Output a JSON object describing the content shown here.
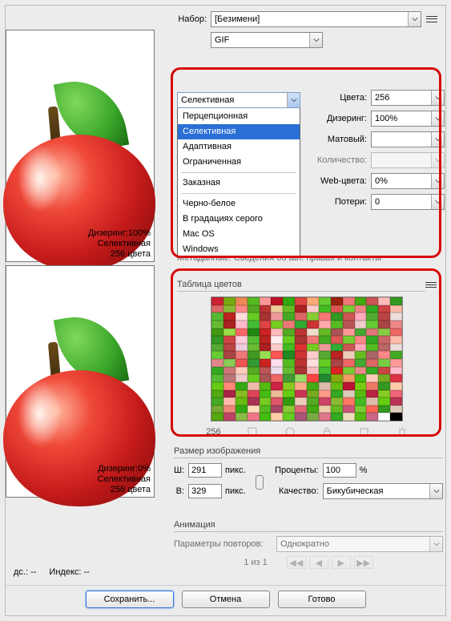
{
  "header": {
    "nabor_label": "Набор:",
    "nabor_value": "[Безимени]",
    "format": "GIF"
  },
  "preview1": {
    "dither": "Дизеринг:100%",
    "algo": "Селективная",
    "colors": "256 цвета"
  },
  "preview2": {
    "dither": "Дизеринг:0%",
    "algo": "Селективная",
    "colors": "256 цвета"
  },
  "dropdown": {
    "current": "Селективная",
    "options": [
      "Перцепционная",
      "Селективная",
      "Адаптивная",
      "Ограниченная",
      "Заказная",
      "Черно-белое",
      "В градациях серого",
      "Mac OS",
      "Windows"
    ]
  },
  "settings": {
    "colors_label": "Цвета:",
    "colors_value": "256",
    "dither_label": "Дизеринг:",
    "dither_value": "100%",
    "matte_label": "Матовый:",
    "matte_value": "",
    "qty_label": "Количество:",
    "qty_value": "",
    "web_label": "Web-цвета:",
    "web_value": "0%",
    "loss_label": "Потери:",
    "loss_value": "0"
  },
  "metadata_line": "Метаданные:   Сведения об авт. правах и контакты",
  "color_table": {
    "title": "Таблица цветов",
    "count": "256"
  },
  "size": {
    "title": "Размер изображения",
    "w_label": "Ш:",
    "w_value": "291",
    "h_label": "В:",
    "h_value": "329",
    "unit": "пикс.",
    "pct_label": "Проценты:",
    "pct_value": "100",
    "pct_unit": "%",
    "quality_label": "Качество:",
    "quality_value": "Бикубическая"
  },
  "anim": {
    "title": "Анимация",
    "repeat_label": "Параметры повторов:",
    "repeat_value": "Однократно",
    "page": "1 из 1"
  },
  "status": {
    "doc": "дс.: --",
    "index": "Индекс: --"
  },
  "buttons": {
    "save": "Сохранить...",
    "cancel": "Отмена",
    "done": "Готово"
  },
  "palette": [
    "#c23",
    "#7a1",
    "#e85",
    "#5b2",
    "#f99",
    "#b12",
    "#3a1",
    "#d44",
    "#fa7",
    "#6c3",
    "#921",
    "#e77",
    "#4a1",
    "#c55",
    "#fbb",
    "#392",
    "#d66",
    "#8b3",
    "#f88",
    "#5a2",
    "#b33",
    "#ec9",
    "#6b2",
    "#a22",
    "#fcc",
    "#4b2",
    "#d55",
    "#7c3",
    "#e88",
    "#3a2",
    "#c44",
    "#fba",
    "#5b3",
    "#b22",
    "#fdd",
    "#6c2",
    "#a33",
    "#e99",
    "#4a2",
    "#d66",
    "#8c3",
    "#f77",
    "#392",
    "#c55",
    "#fab",
    "#5a3",
    "#b44",
    "#edd",
    "#6b3",
    "#a22",
    "#fbc",
    "#4b3",
    "#d44",
    "#7c2",
    "#e77",
    "#3a3",
    "#c33",
    "#faa",
    "#5b2",
    "#b55",
    "#ecc",
    "#6c3",
    "#a44",
    "#e88",
    "#491",
    "#9d4",
    "#f66",
    "#281",
    "#c22",
    "#fbb",
    "#5a2",
    "#b33",
    "#edc",
    "#6b2",
    "#a55",
    "#f99",
    "#4a3",
    "#d77",
    "#8c4",
    "#e66",
    "#392",
    "#c44",
    "#fcd",
    "#5b3",
    "#b22",
    "#fee",
    "#6c2",
    "#a33",
    "#e77",
    "#4a2",
    "#d55",
    "#7c3",
    "#f88",
    "#3a2",
    "#c66",
    "#fba",
    "#5a3",
    "#b44",
    "#ecd",
    "#6b3",
    "#a22",
    "#fcc",
    "#4b2",
    "#d33",
    "#7c2",
    "#e99",
    "#3a3",
    "#c55",
    "#fab",
    "#5b2",
    "#b66",
    "#edd",
    "#6c3",
    "#a44",
    "#e77",
    "#492",
    "#9d5",
    "#f55",
    "#282",
    "#c33",
    "#fcc",
    "#5a3",
    "#b22",
    "#ecb",
    "#6b2",
    "#a66",
    "#f88",
    "#4a2",
    "#d88",
    "#8c5",
    "#e55",
    "#393",
    "#c22",
    "#fde",
    "#5b2",
    "#b33",
    "#fdd",
    "#6c2",
    "#a44",
    "#e66",
    "#4a3",
    "#d66",
    "#7c4",
    "#f99",
    "#3a2",
    "#c77",
    "#fcb",
    "#5a2",
    "#b55",
    "#ede",
    "#6b3",
    "#a33",
    "#fbb",
    "#4b3",
    "#d22",
    "#7c3",
    "#e88",
    "#3a2",
    "#c44",
    "#fbc",
    "#5b3",
    "#b77",
    "#ecc",
    "#6c2",
    "#a55",
    "#e66",
    "#493",
    "#9d6",
    "#f44",
    "#283",
    "#8a1",
    "#e96",
    "#4b1",
    "#fcb",
    "#7a2",
    "#d34",
    "#6c1",
    "#f87",
    "#3a1",
    "#eba",
    "#5b1",
    "#c24",
    "#8c2",
    "#fa8",
    "#4a1",
    "#dba",
    "#6b1",
    "#b13",
    "#7c1",
    "#e76",
    "#392",
    "#fca",
    "#5a1",
    "#a24",
    "#8b2",
    "#d45",
    "#4b1",
    "#eb9",
    "#6c1",
    "#c35",
    "#7a2",
    "#f98",
    "#3a2",
    "#dcb",
    "#5b1",
    "#b24",
    "#8c2",
    "#e67",
    "#4a2",
    "#fba",
    "#6b1",
    "#a35",
    "#7c2",
    "#d56",
    "#391",
    "#ecb",
    "#5a2",
    "#c46",
    "#8b3",
    "#f76",
    "#4b2",
    "#dba",
    "#6c1",
    "#b35",
    "#7a3",
    "#e87",
    "#3a1",
    "#fdb",
    "#5b2",
    "#a46",
    "#8c3",
    "#d67",
    "#4a1",
    "#eca",
    "#6b2",
    "#c57",
    "#7c3",
    "#f65",
    "#392",
    "#dcb",
    "#5a1",
    "#b46",
    "#8b4",
    "#e78",
    "#4b1",
    "#fca",
    "#6c2",
    "#a57",
    "#7a4",
    "#d78",
    "#3a2",
    "#edb",
    "#5b1",
    "#c68",
    "#fff",
    "#000"
  ]
}
